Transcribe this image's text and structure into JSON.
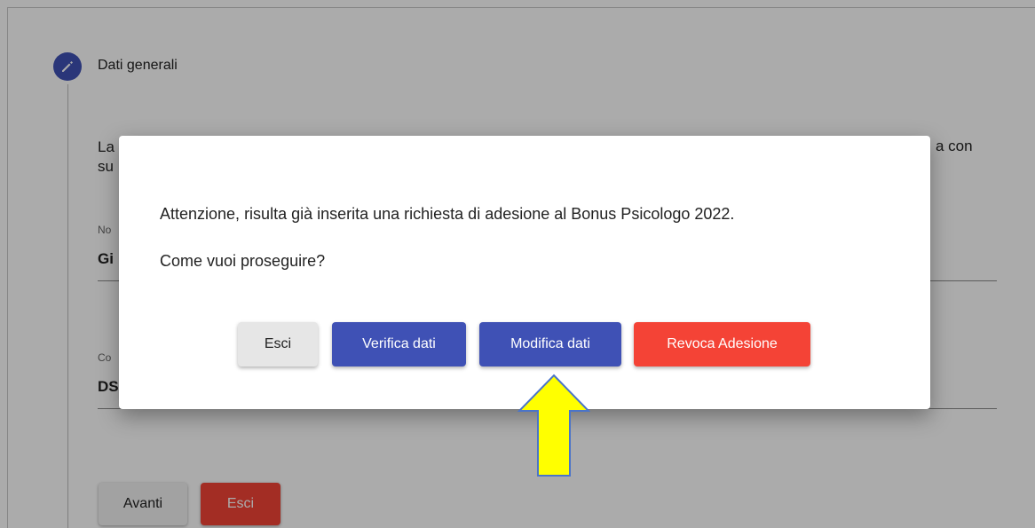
{
  "stepper": {
    "step_icon": "pencil-icon",
    "step_title": "Dati generali",
    "intro_partial_left": "La",
    "intro_partial_left_line2": "su",
    "intro_partial_right": "a con"
  },
  "fields": [
    {
      "label": "No",
      "value": "Gi"
    },
    {
      "label": "Co",
      "value": "DS"
    }
  ],
  "page_buttons": {
    "avanti": "Avanti",
    "esci": "Esci"
  },
  "dialog": {
    "message": "Attenzione, risulta già inserita una richiesta di adesione al Bonus Psicologo 2022.",
    "question": "Come vuoi proseguire?",
    "buttons": {
      "esci": "Esci",
      "verifica": "Verifica dati",
      "modifica": "Modifica dati",
      "revoca": "Revoca Adesione"
    }
  },
  "annotation": {
    "arrow_icon": "up-arrow-icon",
    "arrow_color": "#ffff00"
  },
  "colors": {
    "primary": "#3f51b5",
    "danger": "#f44336",
    "neutral": "#e6e6e6"
  }
}
